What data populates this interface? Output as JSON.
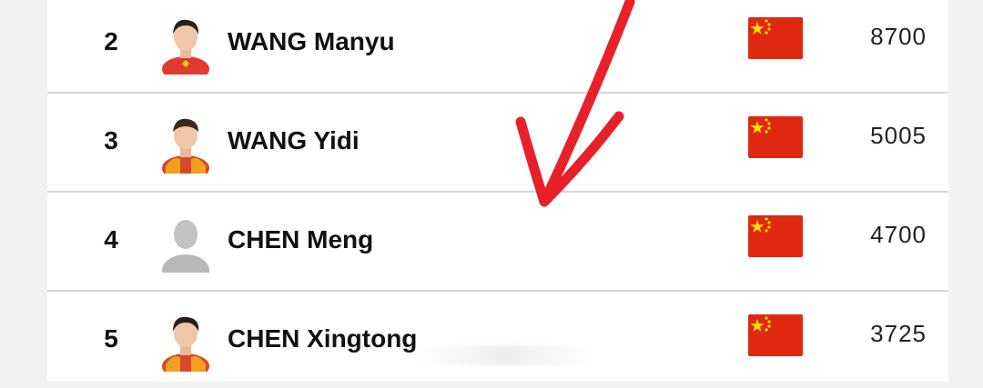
{
  "rankings": [
    {
      "rank": "2",
      "name": "WANG Manyu",
      "points": "8700",
      "avatar": "player-photo",
      "flag": "china-flag"
    },
    {
      "rank": "3",
      "name": "WANG Yidi",
      "points": "5005",
      "avatar": "player-photo",
      "flag": "china-flag"
    },
    {
      "rank": "4",
      "name": "CHEN Meng",
      "points": "4700",
      "avatar": "placeholder-silhouette",
      "flag": "china-flag"
    },
    {
      "rank": "5",
      "name": "CHEN Xingtong",
      "points": "3725",
      "avatar": "player-photo",
      "flag": "china-flag"
    }
  ],
  "colors": {
    "flag_red": "#de2910",
    "flag_star": "#ffde00",
    "arrow_red": "#e8202a",
    "row_bg": "#ffffff",
    "divider": "#d6d6d8"
  }
}
